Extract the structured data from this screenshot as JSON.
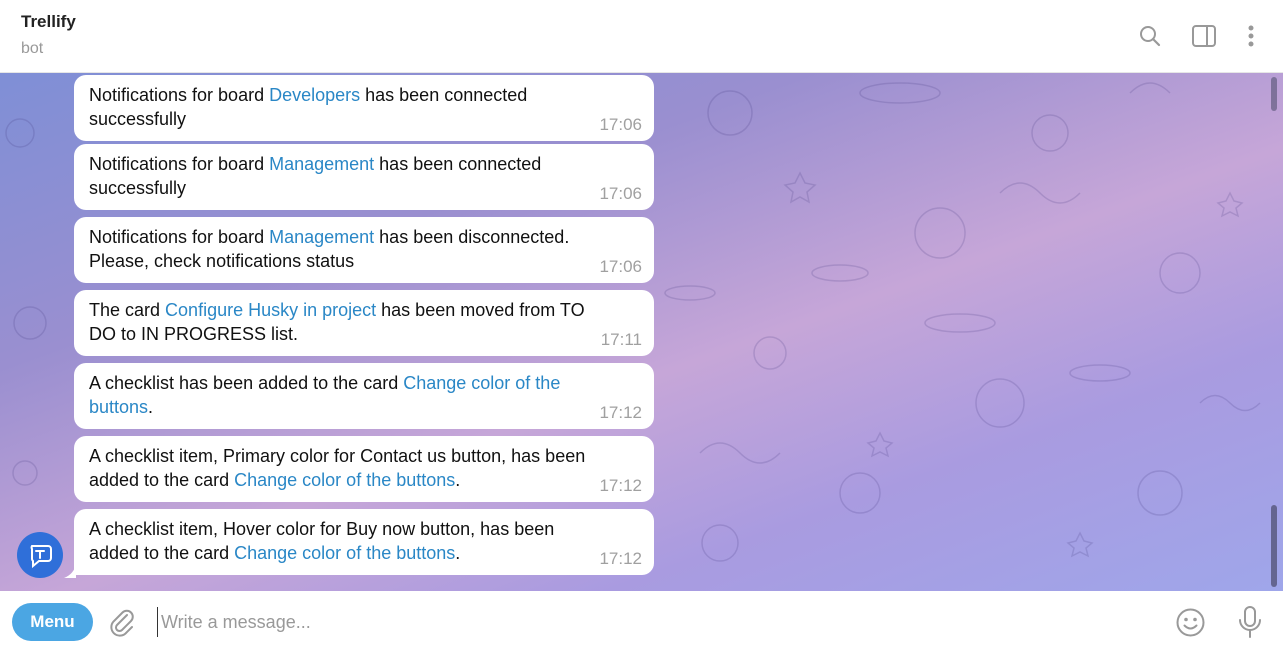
{
  "header": {
    "title": "Trellify",
    "subtitle": "bot"
  },
  "messages": [
    {
      "pre": "Notifications for board ",
      "link": "Developers",
      "post": " has been connected successfully",
      "time": "17:06"
    },
    {
      "pre": "Notifications for board ",
      "link": "Management",
      "post": " has been connected successfully",
      "time": "17:06"
    },
    {
      "pre": "Notifications for board ",
      "link": "Management",
      "post": " has been disconnected. Please, check notifications status",
      "time": "17:06"
    },
    {
      "pre": "The card ",
      "link": "Configure Husky in project",
      "post": " has been moved from TO DO to IN PROGRESS list.",
      "time": "17:11"
    },
    {
      "pre": "A checklist has been added to the card ",
      "link": "Change color of the buttons",
      "post": ".",
      "time": "17:12"
    },
    {
      "pre": "A checklist item, Primary color for Contact us button, has been added to the card ",
      "link": "Change color of the buttons",
      "post": ".",
      "time": "17:12"
    },
    {
      "pre": "A checklist item, Hover color for Buy now button, has been added to the card ",
      "link": "Change color of the buttons",
      "post": ".",
      "time": "17:12"
    }
  ],
  "composer": {
    "menu_label": "Menu",
    "placeholder": "Write a message..."
  },
  "icons": {
    "header": [
      "search-icon",
      "sidebar-toggle-icon",
      "more-vertical-icon"
    ],
    "composer": [
      "paperclip-icon",
      "emoji-icon",
      "microphone-icon"
    ],
    "avatar": "trellify-bot-avatar"
  },
  "colors": {
    "link": "#2a87c6",
    "menu_button": "#4ba6e3",
    "avatar": "#2f6fd9"
  }
}
